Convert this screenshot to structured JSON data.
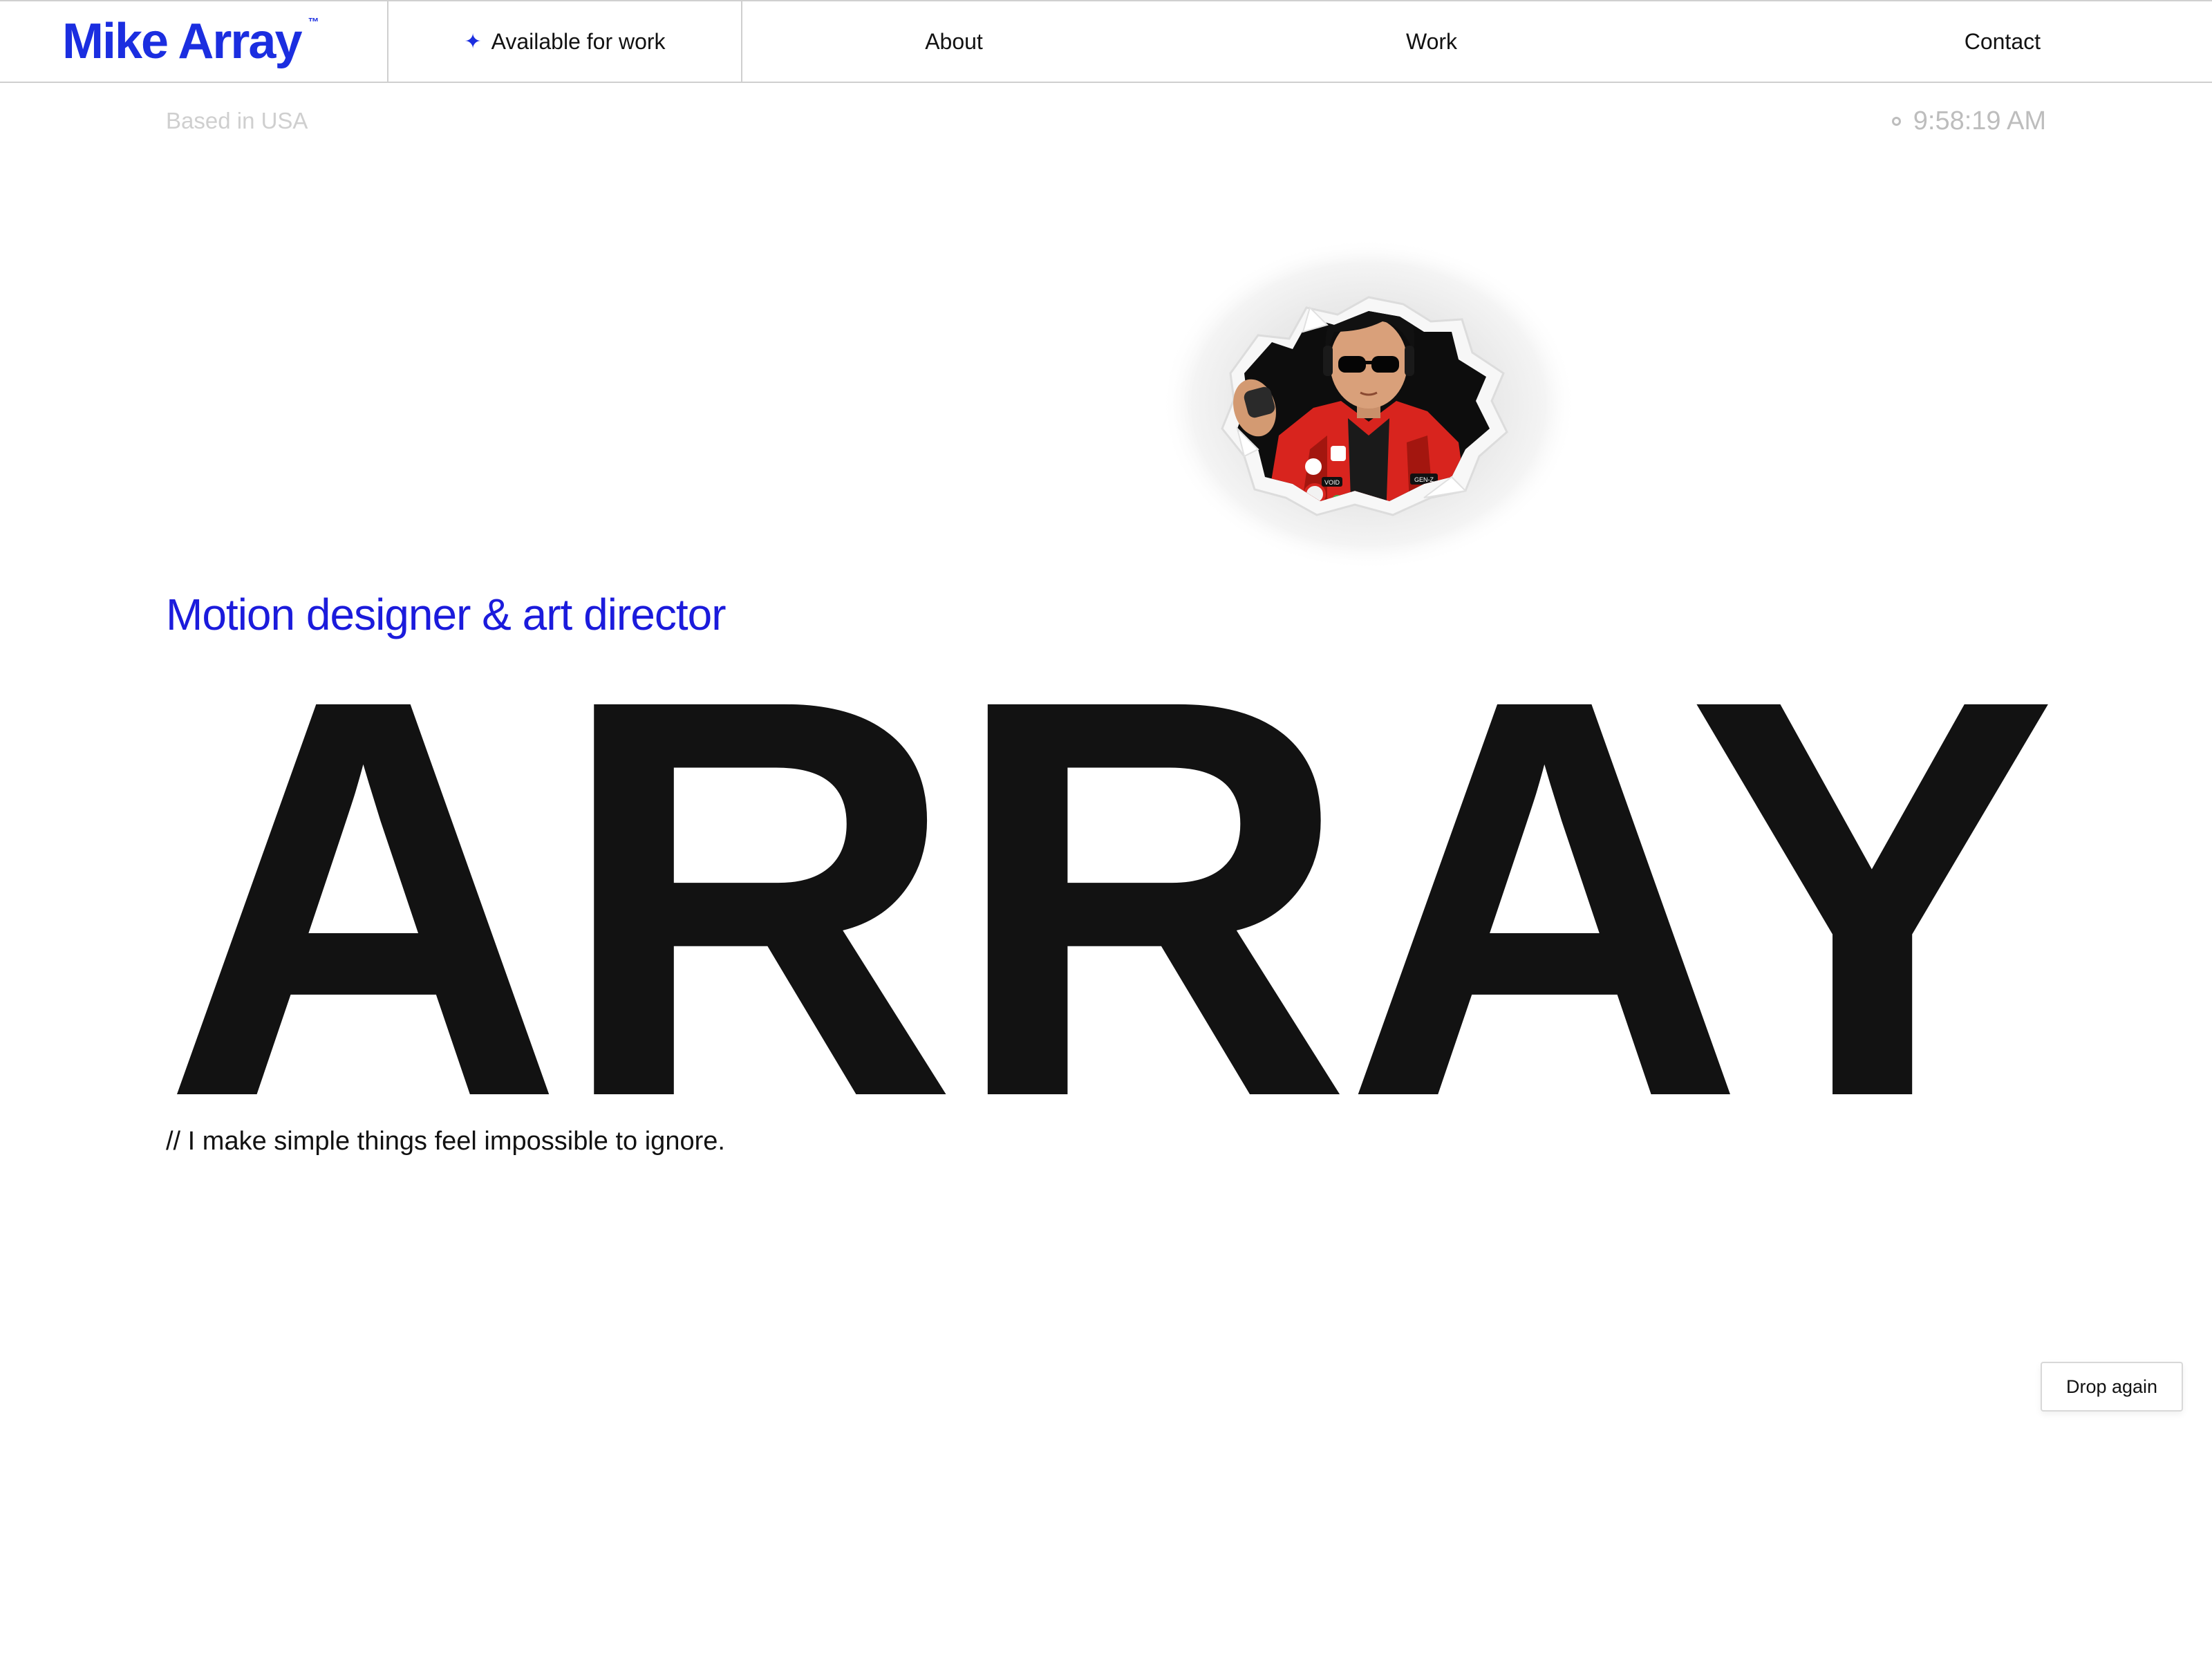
{
  "nav": {
    "brand": "Mike Array",
    "brand_mark": "™",
    "availability_icon": "sparkle-icon",
    "availability": "Available for work",
    "links": {
      "about": "About",
      "work": "Work",
      "contact": "Contact"
    }
  },
  "meta": {
    "location": "Based in USA",
    "time": "9:58:19 AM",
    "time_icon": "clock-dot-icon"
  },
  "hero": {
    "avatar_icon": "avatar-torn-paper-illustration",
    "avatar_badges": [
      "VOID",
      "GEN-Z"
    ],
    "role": "Motion designer & art director",
    "name": "ARRAY",
    "tagline": "// I make simple things feel impossible to ignore."
  },
  "actions": {
    "drop_again": "Drop again"
  },
  "colors": {
    "accent": "#1b2ee0",
    "text": "#121212",
    "muted": "#bdbdbd",
    "border": "#cfcfcf",
    "jacket_red": "#d8241e"
  }
}
